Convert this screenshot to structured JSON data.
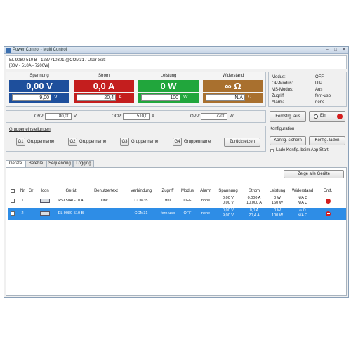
{
  "window": {
    "title": "Power Control - Multi Control",
    "controls": [
      "–",
      "□",
      "✕"
    ]
  },
  "device_info": {
    "line1": "EL 9080-510 B - 1237710301 @COM31 / User text:",
    "line2": "[80V - 510A - 7200W]"
  },
  "meters": [
    {
      "label": "Spannung",
      "actual": "0,00 V",
      "set": "9,00",
      "unit": "V",
      "color": "#1e4f9c"
    },
    {
      "label": "Strom",
      "actual": "0,0 A",
      "set": "20,4",
      "unit": "A",
      "color": "#c41e1e"
    },
    {
      "label": "Leistung",
      "actual": "0 W",
      "set": "100",
      "unit": "W",
      "color": "#21a63c"
    },
    {
      "label": "Widerstand",
      "actual": "∞ Ω",
      "set": "N/A",
      "unit": "Ω",
      "color": "#a9702e"
    }
  ],
  "status": [
    {
      "key": "Modus:",
      "value": "OFF"
    },
    {
      "key": "OP-Modus:",
      "value": "UIP"
    },
    {
      "key": "MS-Modus:",
      "value": "Aus"
    },
    {
      "key": "Zugriff:",
      "value": "fern-usb"
    },
    {
      "key": "Alarm:",
      "value": "none"
    }
  ],
  "protection": {
    "ovp_label": "OVP:",
    "ovp_value": "80,00",
    "ovp_unit": "V",
    "ocp_label": "OCP:",
    "ocp_value": "510,0",
    "ocp_unit": "A",
    "opp_label": "OPP:",
    "opp_value": "7200",
    "opp_unit": "W"
  },
  "remote": {
    "button_label": "Fernstrg. aus",
    "ein_label": "Ein",
    "led_color": "#d41e1e"
  },
  "groups": {
    "title": "Gruppeneinstellungen",
    "items": [
      {
        "id": "G1",
        "name": "Gruppenname"
      },
      {
        "id": "G2",
        "name": "Gruppenname"
      },
      {
        "id": "G3",
        "name": "Gruppenname"
      },
      {
        "id": "G4",
        "name": "Gruppenname"
      }
    ],
    "reset_label": "Zurücksetzen"
  },
  "config": {
    "title": "Konfiguration",
    "save_label": "Konfig. sichern",
    "load_label": "Konfig. laden",
    "autoload_label": "Lade Konfig. beim App Start"
  },
  "tabs": [
    "Geräte",
    "Befehle",
    "Sequencing",
    "Logging"
  ],
  "devices": {
    "show_all_label": "Zeige alle Geräte",
    "headers": [
      "Nr",
      "Gr",
      "Icon",
      "Gerät",
      "Benutzertext",
      "Verbindung",
      "Zugriff",
      "Modus",
      "Alarm",
      "Spannung",
      "Strom",
      "Leistung",
      "Widerstand",
      "Entf."
    ],
    "rows": [
      {
        "nr": "1",
        "gr": "",
        "device": "PSI 5040-10 A",
        "usertext": "Unit 1",
        "connection": "COM35",
        "access": "frei",
        "mode": "OFF",
        "alarm": "none",
        "voltage1": "0,00 V",
        "voltage2": "0,00 V",
        "current1": "0,000 A",
        "current2": "10,000 A",
        "power1": "0 W",
        "power2": "160 W",
        "res1": "N/A Ω",
        "res2": "N/A Ω",
        "selected": false
      },
      {
        "nr": "2",
        "gr": "",
        "device": "EL 9080-510 B",
        "usertext": "",
        "connection": "COM31",
        "access": "fern-usb",
        "mode": "OFF",
        "alarm": "none",
        "voltage1": "0,00 V",
        "voltage2": "9,00 V",
        "current1": "0,0 A",
        "current2": "20,4 A",
        "power1": "0 W",
        "power2": "100 W",
        "res1": "∞ Ω",
        "res2": "N/A Ω",
        "selected": true
      }
    ]
  }
}
